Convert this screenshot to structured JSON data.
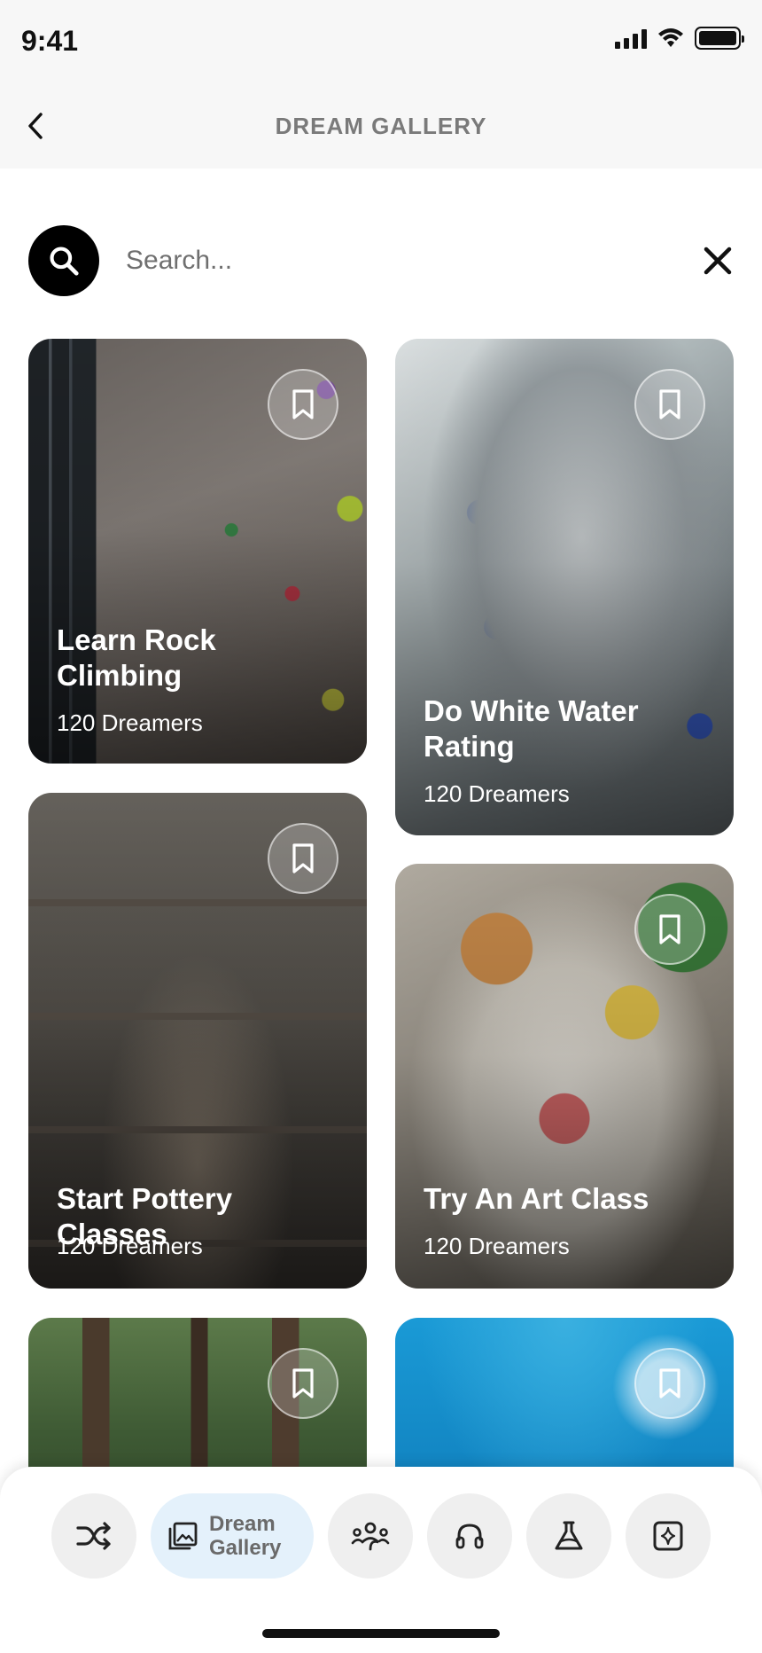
{
  "status_bar": {
    "time": "9:41",
    "icons": [
      "signal-icon",
      "wifi-icon",
      "battery-icon"
    ]
  },
  "header": {
    "back_icon": "chevron-left-icon",
    "title": "DREAM GALLERY"
  },
  "search": {
    "placeholder": "Search...",
    "value": "",
    "search_icon": "search-icon",
    "clear_icon": "close-icon"
  },
  "cards": [
    {
      "title": "Learn Rock Climbing",
      "subtitle": "120 Dreamers",
      "bookmark_icon": "bookmark-icon"
    },
    {
      "title": "Do White Water Rating",
      "subtitle": "120 Dreamers",
      "bookmark_icon": "bookmark-icon"
    },
    {
      "title": "Start Pottery Classes",
      "subtitle": "120 Dreamers",
      "bookmark_icon": "bookmark-icon"
    },
    {
      "title": "Try An Art Class",
      "subtitle": "120 Dreamers",
      "bookmark_icon": "bookmark-icon"
    },
    {
      "title": "",
      "subtitle": "",
      "bookmark_icon": "bookmark-icon"
    },
    {
      "title": "",
      "subtitle": "",
      "bookmark_icon": "bookmark-icon"
    }
  ],
  "bottom_nav": {
    "items": [
      {
        "icon": "shuffle-icon",
        "label": ""
      },
      {
        "icon": "gallery-icon",
        "label": "Dream Gallery",
        "active": true
      },
      {
        "icon": "community-icon",
        "label": ""
      },
      {
        "icon": "headphones-icon",
        "label": ""
      },
      {
        "icon": "lab-flask-icon",
        "label": ""
      },
      {
        "icon": "sparkle-icon",
        "label": ""
      }
    ],
    "active_bg": "#e4f1fb",
    "inactive_bg": "#efefef"
  }
}
